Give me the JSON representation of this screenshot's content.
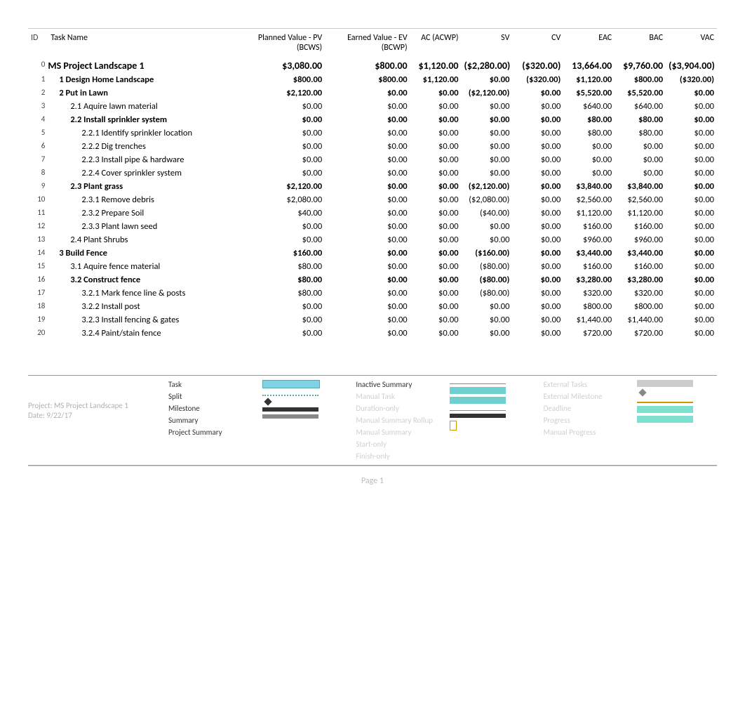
{
  "columns": {
    "id": "ID",
    "task": "Task Name",
    "pv": "Planned Value - PV (BCWS)",
    "ev": "Earned Value - EV (BCWP)",
    "ac": "AC (ACWP)",
    "sv": "SV",
    "cv": "CV",
    "eac": "EAC",
    "bac": "BAC",
    "vac": "VAC"
  },
  "rows": [
    {
      "id": "0",
      "level": 0,
      "bold": true,
      "task": "MS Project  Landscape 1",
      "pv": "$3,080.00",
      "ev": "$800.00",
      "ac": "$1,120.00",
      "sv": "($2,280.00)",
      "cv": "($320.00)",
      "eac": "13,664.00",
      "bac": "$9,760.00",
      "vac": "($3,904.00)"
    },
    {
      "id": "1",
      "level": 1,
      "bold": false,
      "task": "1 Design Home Landscape",
      "pv": "$800.00",
      "ev": "$800.00",
      "ac": "$1,120.00",
      "sv": "$0.00",
      "cv": "($320.00)",
      "eac": "$1,120.00",
      "bac": "$800.00",
      "vac": "($320.00)"
    },
    {
      "id": "2",
      "level": 1,
      "bold": true,
      "task": "2 Put in Lawn",
      "pv": "$2,120.00",
      "ev": "$0.00",
      "ac": "$0.00",
      "sv": "($2,120.00)",
      "cv": "$0.00",
      "eac": "$5,520.00",
      "bac": "$5,520.00",
      "vac": "$0.00"
    },
    {
      "id": "3",
      "level": 2,
      "bold": false,
      "task": "2.1 Aquire lawn material",
      "pv": "$0.00",
      "ev": "$0.00",
      "ac": "$0.00",
      "sv": "$0.00",
      "cv": "$0.00",
      "eac": "$640.00",
      "bac": "$640.00",
      "vac": "$0.00"
    },
    {
      "id": "4",
      "level": 2,
      "bold": true,
      "task": "2.2 Install sprinkler system",
      "pv": "$0.00",
      "ev": "$0.00",
      "ac": "$0.00",
      "sv": "$0.00",
      "cv": "$0.00",
      "eac": "$80.00",
      "bac": "$80.00",
      "vac": "$0.00"
    },
    {
      "id": "5",
      "level": 3,
      "bold": false,
      "task": "2.2.1 Identify sprinkler location",
      "pv": "$0.00",
      "ev": "$0.00",
      "ac": "$0.00",
      "sv": "$0.00",
      "cv": "$0.00",
      "eac": "$80.00",
      "bac": "$80.00",
      "vac": "$0.00"
    },
    {
      "id": "6",
      "level": 3,
      "bold": false,
      "task": "2.2.2 Dig trenches",
      "pv": "$0.00",
      "ev": "$0.00",
      "ac": "$0.00",
      "sv": "$0.00",
      "cv": "$0.00",
      "eac": "$0.00",
      "bac": "$0.00",
      "vac": "$0.00"
    },
    {
      "id": "7",
      "level": 3,
      "bold": false,
      "task": "2.2.3 Install pipe & hardware",
      "pv": "$0.00",
      "ev": "$0.00",
      "ac": "$0.00",
      "sv": "$0.00",
      "cv": "$0.00",
      "eac": "$0.00",
      "bac": "$0.00",
      "vac": "$0.00"
    },
    {
      "id": "8",
      "level": 3,
      "bold": false,
      "task": "2.2.4 Cover sprinkler system",
      "pv": "$0.00",
      "ev": "$0.00",
      "ac": "$0.00",
      "sv": "$0.00",
      "cv": "$0.00",
      "eac": "$0.00",
      "bac": "$0.00",
      "vac": "$0.00"
    },
    {
      "id": "9",
      "level": 2,
      "bold": true,
      "task": "2.3 Plant grass",
      "pv": "$2,120.00",
      "ev": "$0.00",
      "ac": "$0.00",
      "sv": "($2,120.00)",
      "cv": "$0.00",
      "eac": "$3,840.00",
      "bac": "$3,840.00",
      "vac": "$0.00"
    },
    {
      "id": "10",
      "level": 3,
      "bold": false,
      "task": "2.3.1 Remove debris",
      "pv": "$2,080.00",
      "ev": "$0.00",
      "ac": "$0.00",
      "sv": "($2,080.00)",
      "cv": "$0.00",
      "eac": "$2,560.00",
      "bac": "$2,560.00",
      "vac": "$0.00"
    },
    {
      "id": "11",
      "level": 3,
      "bold": false,
      "task": "2.3.2 Prepare Soil",
      "pv": "$40.00",
      "ev": "$0.00",
      "ac": "$0.00",
      "sv": "($40.00)",
      "cv": "$0.00",
      "eac": "$1,120.00",
      "bac": "$1,120.00",
      "vac": "$0.00"
    },
    {
      "id": "12",
      "level": 3,
      "bold": false,
      "task": "2.3.3 Plant lawn seed",
      "pv": "$0.00",
      "ev": "$0.00",
      "ac": "$0.00",
      "sv": "$0.00",
      "cv": "$0.00",
      "eac": "$160.00",
      "bac": "$160.00",
      "vac": "$0.00"
    },
    {
      "id": "13",
      "level": 2,
      "bold": false,
      "task": "2.4 Plant Shrubs",
      "pv": "$0.00",
      "ev": "$0.00",
      "ac": "$0.00",
      "sv": "$0.00",
      "cv": "$0.00",
      "eac": "$960.00",
      "bac": "$960.00",
      "vac": "$0.00"
    },
    {
      "id": "14",
      "level": 1,
      "bold": true,
      "task": "3 Build Fence",
      "pv": "$160.00",
      "ev": "$0.00",
      "ac": "$0.00",
      "sv": "($160.00)",
      "cv": "$0.00",
      "eac": "$3,440.00",
      "bac": "$3,440.00",
      "vac": "$0.00"
    },
    {
      "id": "15",
      "level": 2,
      "bold": false,
      "task": "3.1 Aquire fence material",
      "pv": "$80.00",
      "ev": "$0.00",
      "ac": "$0.00",
      "sv": "($80.00)",
      "cv": "$0.00",
      "eac": "$160.00",
      "bac": "$160.00",
      "vac": "$0.00"
    },
    {
      "id": "16",
      "level": 2,
      "bold": true,
      "task": "3.2 Construct fence",
      "pv": "$80.00",
      "ev": "$0.00",
      "ac": "$0.00",
      "sv": "($80.00)",
      "cv": "$0.00",
      "eac": "$3,280.00",
      "bac": "$3,280.00",
      "vac": "$0.00"
    },
    {
      "id": "17",
      "level": 3,
      "bold": false,
      "task": "3.2.1 Mark fence line & posts",
      "pv": "$80.00",
      "ev": "$0.00",
      "ac": "$0.00",
      "sv": "($80.00)",
      "cv": "$0.00",
      "eac": "$320.00",
      "bac": "$320.00",
      "vac": "$0.00"
    },
    {
      "id": "18",
      "level": 3,
      "bold": false,
      "task": "3.2.2 Install post",
      "pv": "$0.00",
      "ev": "$0.00",
      "ac": "$0.00",
      "sv": "$0.00",
      "cv": "$0.00",
      "eac": "$800.00",
      "bac": "$800.00",
      "vac": "$0.00"
    },
    {
      "id": "19",
      "level": 3,
      "bold": false,
      "task": "3.2.3 Install fencing & gates",
      "pv": "$0.00",
      "ev": "$0.00",
      "ac": "$0.00",
      "sv": "$0.00",
      "cv": "$0.00",
      "eac": "$1,440.00",
      "bac": "$1,440.00",
      "vac": "$0.00"
    },
    {
      "id": "20",
      "level": 3,
      "bold": false,
      "task": "3.2.4 Paint/stain fence",
      "pv": "$0.00",
      "ev": "$0.00",
      "ac": "$0.00",
      "sv": "$0.00",
      "cv": "$0.00",
      "eac": "$720.00",
      "bac": "$720.00",
      "vac": "$0.00"
    }
  ],
  "legend": {
    "title_line1": "Project: MS Project  Landscape 1",
    "title_line2": "Date: 9/22/17",
    "col1": [
      "Task",
      "Split",
      "Milestone",
      "Summary",
      "Project Summary"
    ],
    "col2_label": "Inactive Summary",
    "ghost_col2": [
      "Manual Task",
      "Duration-only",
      "Manual Summary Rollup",
      "Manual Summary",
      "Start-only",
      "Finish-only"
    ],
    "ghost_col3": [
      "External Tasks",
      "External Milestone",
      "Deadline",
      "Progress",
      "Manual Progress"
    ]
  },
  "page_number": "Page 1"
}
